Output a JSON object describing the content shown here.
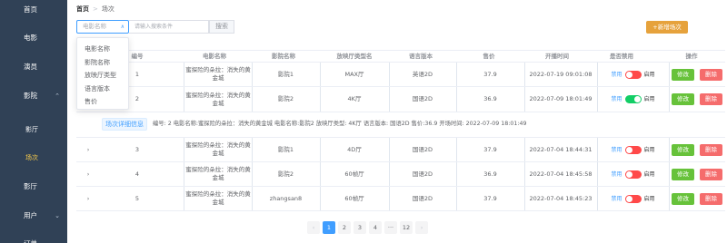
{
  "sidebar": {
    "items": [
      {
        "label": "首页"
      },
      {
        "label": "电影"
      },
      {
        "label": "演员"
      },
      {
        "label": "影院"
      },
      {
        "label": "影厅"
      },
      {
        "label": "场次"
      },
      {
        "label": "影厅"
      },
      {
        "label": "用户"
      },
      {
        "label": "订单"
      }
    ]
  },
  "breadcrumb": {
    "home": "首页",
    "separator": ">",
    "current": "场次"
  },
  "search": {
    "select_value": "电影名称",
    "placeholder": "请输入搜索条件",
    "button": "搜索",
    "dropdown_options": [
      "电影名称",
      "影院名称",
      "放映厅类型",
      "语言版本",
      "售价"
    ]
  },
  "add_button": "+新增场次",
  "table": {
    "headers": [
      "编号",
      "电影名称",
      "影院名称",
      "放映厅类型名",
      "语言版本",
      "售价",
      "开播时间",
      "是否禁用",
      "操作"
    ],
    "rows": [
      {
        "id": "1",
        "movie": "蜜探险的朵拉：消失的黄金城",
        "cinema": "影院1",
        "hall": "MAX厅",
        "lang": "英语2D",
        "price": "37.9",
        "time": "2022-07-19 09:01:08",
        "enabled": false
      },
      {
        "id": "2",
        "movie": "蜜探险的朵拉：消失的黄金城",
        "cinema": "影院2",
        "hall": "4K厅",
        "lang": "国语2D",
        "price": "36.9",
        "time": "2022-07-09 18:01:49",
        "enabled": true
      },
      {
        "id": "3",
        "movie": "蜜探险的朵拉：消失的黄金城",
        "cinema": "影院1",
        "hall": "4D厅",
        "lang": "国语2D",
        "price": "37.9",
        "time": "2022-07-04 18:44:31",
        "enabled": false
      },
      {
        "id": "4",
        "movie": "蜜探险的朵拉：消失的黄金城",
        "cinema": "影院2",
        "hall": "60帧厅",
        "lang": "国语2D",
        "price": "36.9",
        "time": "2022-07-04 18:45:58",
        "enabled": false
      },
      {
        "id": "5",
        "movie": "蜜探险的朵拉：消失的黄金城",
        "cinema": "zhangsan8",
        "hall": "60帧厅",
        "lang": "国语2D",
        "price": "37.9",
        "time": "2022-07-04 18:45:23",
        "enabled": false
      }
    ],
    "toggle_off_label": "禁用",
    "toggle_on_label": "启用",
    "edit_label": "修改",
    "delete_label": "删除"
  },
  "detail": {
    "tag": "场次详细信息",
    "text": "编号: 2    电影名称:蜜探险的朵拉：消失的黄金城    电影名称:影院2  放映厅类型: 4K厅   语言版本: 国语2D   售价:36.9   开场时间: 2022-07-09 18:01:49"
  },
  "pagination": {
    "prev": "‹",
    "pages": [
      "1",
      "2",
      "3",
      "4",
      "···",
      "12"
    ],
    "next": "›",
    "current": "1"
  },
  "colors": {
    "sidebar": "#304156",
    "active_menu": "#ffd04b",
    "primary": "#409eff",
    "warning": "#e6a23c",
    "success": "#67c23a",
    "danger": "#f56c6c"
  }
}
